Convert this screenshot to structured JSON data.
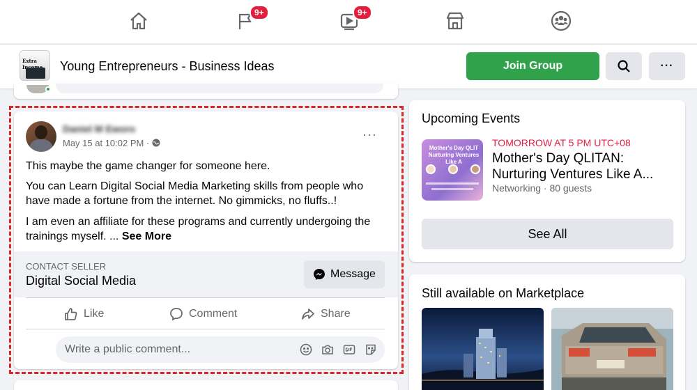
{
  "nav": {
    "items": [
      {
        "name": "home-icon"
      },
      {
        "name": "pages-flag-icon",
        "badge": "9+"
      },
      {
        "name": "watch-video-icon",
        "badge": "9+"
      },
      {
        "name": "marketplace-icon"
      },
      {
        "name": "groups-icon"
      }
    ]
  },
  "group": {
    "name": "Young Entrepreneurs - Business Ideas",
    "thumb_text": "Extra Income",
    "join_label": "Join Group",
    "more_label": "···"
  },
  "post": {
    "author": "Daniel M Eworo",
    "time": "May 15 at 10:02 PM · ",
    "more_label": "···",
    "paragraphs": [
      "This maybe the game changer for someone here.",
      "You can Learn Digital Social Media Marketing skills from people who have made a fortune from the internet. No gimmicks, no fluffs..!",
      "I am even an affiliate for these programs and currently undergoing the trainings myself. ... "
    ],
    "see_more": "See More",
    "seller_label": "CONTACT SELLER",
    "seller_name": "Digital Social Media",
    "message_label": "Message",
    "actions": {
      "like": "Like",
      "comment": "Comment",
      "share": "Share"
    },
    "comment_placeholder": "Write a public comment..."
  },
  "events": {
    "title": "Upcoming Events",
    "thumb_text": "Mother's Day QLIT Nurturing Ventures Like A",
    "time": "TOMORROW AT 5 PM UTC+08",
    "name": "Mother's Day QLITAN: Nurturing Ventures Like A...",
    "meta": "Networking · 80 guests",
    "see_all": "See All"
  },
  "marketplace": {
    "title": "Still available on Marketplace"
  },
  "colors": {
    "brand_green": "#31a24c",
    "badge_red": "#e41e3f",
    "highlight_red": "#d62828"
  }
}
